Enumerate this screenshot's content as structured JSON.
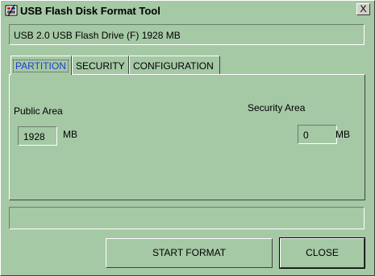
{
  "window": {
    "title": "USB Flash Disk Format Tool",
    "close_glyph": "X",
    "icon": "usb-format-app-icon"
  },
  "device": {
    "description": "USB 2.0  USB Flash Drive  (F)  1928 MB"
  },
  "tabs": [
    {
      "label": "PARTITION",
      "active": true
    },
    {
      "label": "SECURITY",
      "active": false
    },
    {
      "label": "CONFIGURATION",
      "active": false
    }
  ],
  "partition": {
    "public_label": "Public Area",
    "public_value": "1928",
    "public_unit": "MB",
    "security_label": "Security Area",
    "security_value": "0",
    "security_unit": "MB"
  },
  "status": {
    "text": ""
  },
  "buttons": {
    "start_format": "START FORMAT",
    "close": "CLOSE"
  },
  "colors": {
    "background": "#a5c8a5",
    "active_tab_text": "#1a3fd0"
  }
}
